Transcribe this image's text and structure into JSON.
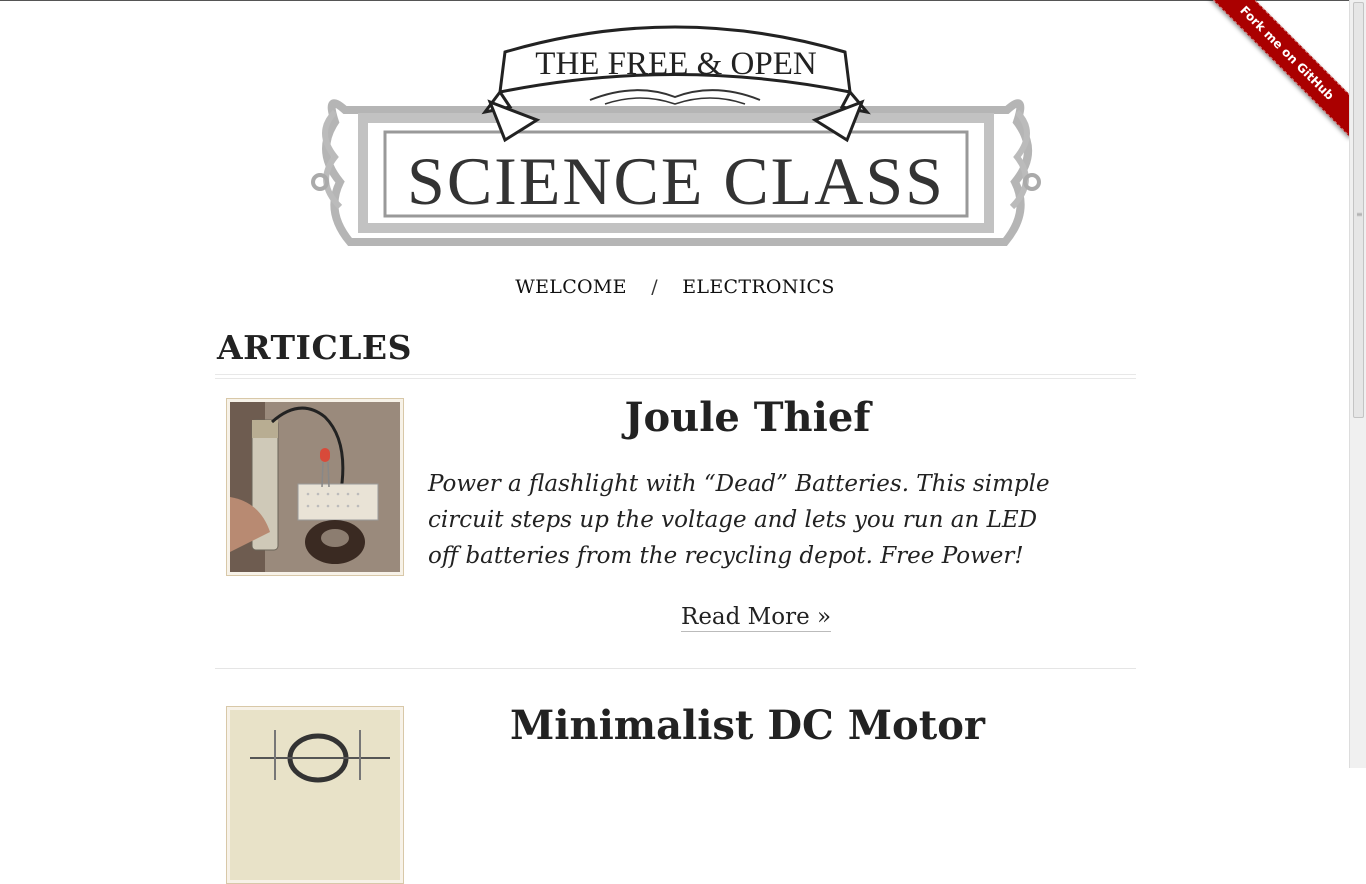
{
  "logo": {
    "banner_text": "THE FREE & OPEN",
    "main_text": "SCIENCE CLASS"
  },
  "ribbon": {
    "label": "Fork me on GitHub"
  },
  "nav": {
    "items": [
      "WELCOME",
      "ELECTRONICS"
    ],
    "separator": "/"
  },
  "section_title": "ARTICLES",
  "articles": [
    {
      "title": "Joule Thief",
      "description": "Power a flashlight with “Dead” Batteries. This simple circuit steps up the voltage and lets you run an LED off batteries from the recycling depot. Free Power!",
      "read_more": "Read More »"
    },
    {
      "title": "Minimalist DC Motor"
    }
  ],
  "colors": {
    "ribbon": "#aa0000",
    "text": "#222222",
    "logo_gray": "#9a9a9a"
  }
}
